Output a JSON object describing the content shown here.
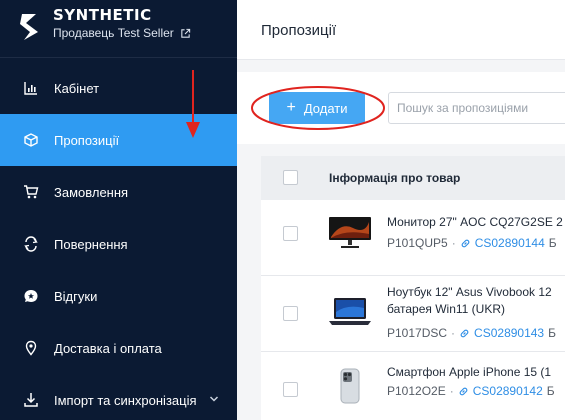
{
  "brand": {
    "name": "SYNTHETIC",
    "seller": "Продавець Test Seller"
  },
  "nav": {
    "items": [
      {
        "label": "Кабінет",
        "icon": "chart-bars-icon"
      },
      {
        "label": "Пропозиції",
        "icon": "box-icon",
        "active": true
      },
      {
        "label": "Замовлення",
        "icon": "cart-icon"
      },
      {
        "label": "Повернення",
        "icon": "return-icon"
      },
      {
        "label": "Відгуки",
        "icon": "review-icon"
      },
      {
        "label": "Доставка і оплата",
        "icon": "location-pin-icon"
      },
      {
        "label": "Імпорт та синхронізація",
        "icon": "sync-icon",
        "has_submenu": true
      }
    ]
  },
  "header": {
    "title": "Пропозиції"
  },
  "toolbar": {
    "add_label": "Додати",
    "search_placeholder": "Пошук за пропозиціями"
  },
  "table": {
    "column_header": "Інформація про товар",
    "rows": [
      {
        "title_line1": "Монитор 27\" AOC CQ27G2SE 2",
        "title_line2": "",
        "sku": "P101QUP5",
        "code": "CS02890144",
        "tail": "Б"
      },
      {
        "title_line1": "Ноутбук 12\" Asus Vivobook 12",
        "title_line2": "батарея Win11 (UKR)",
        "sku": "P1017DSC",
        "code": "CS02890143",
        "tail": "Б"
      },
      {
        "title_line1": "Смартфон Apple iPhone 15 (1",
        "title_line2": "",
        "sku": "P1012O2E",
        "code": "CS02890142",
        "tail": "Б"
      }
    ]
  },
  "colors": {
    "sidebar_bg": "#0b1a33",
    "accent": "#2f9bf2",
    "annotation": "#e0241f"
  }
}
